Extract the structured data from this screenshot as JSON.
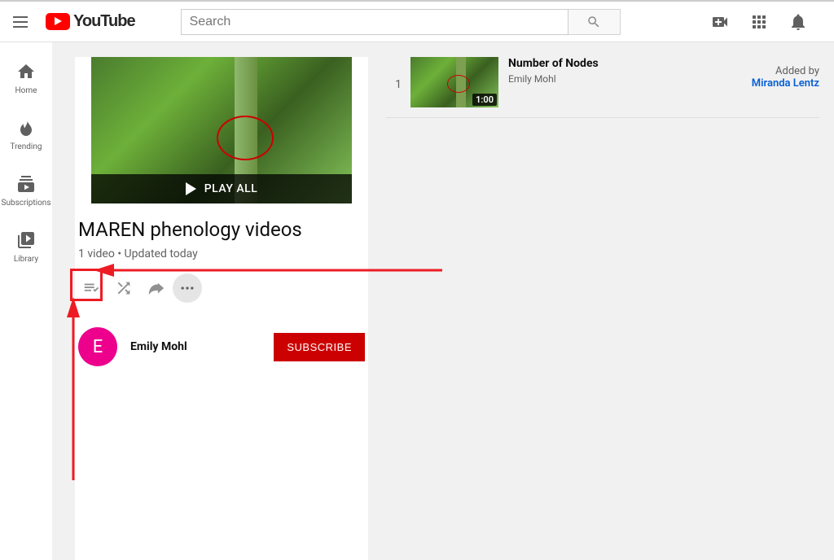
{
  "brand": "YouTube",
  "search": {
    "placeholder": "Search"
  },
  "sidebar": {
    "items": [
      {
        "label": "Home"
      },
      {
        "label": "Trending"
      },
      {
        "label": "Subscriptions"
      },
      {
        "label": "Library"
      }
    ]
  },
  "playlist": {
    "play_all": "PLAY ALL",
    "title": "MAREN phenology videos",
    "video_count": "1 video",
    "updated": "Updated today",
    "meta_sep": " • ",
    "channel": {
      "avatar_letter": "E",
      "name": "Emily Mohl"
    },
    "subscribe": "SUBSCRIBE"
  },
  "videos": [
    {
      "index": "1",
      "title": "Number of Nodes",
      "channel": "Emily Mohl",
      "duration": "1:00",
      "added_label": "Added by",
      "added_by": "Miranda Lentz"
    }
  ]
}
